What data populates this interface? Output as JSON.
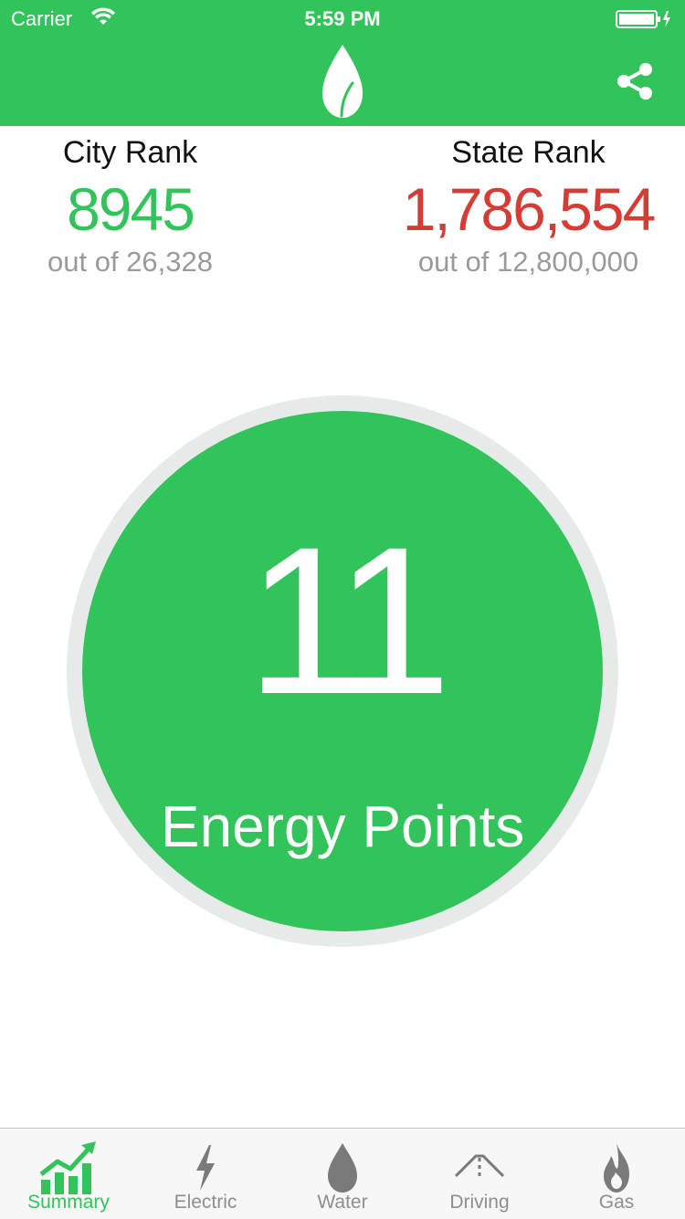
{
  "status_bar": {
    "carrier": "Carrier",
    "time": "5:59 PM"
  },
  "header": {
    "logo_icon": "leaf-icon",
    "share_icon": "share-icon",
    "background_color": "#33c35b"
  },
  "city_rank": {
    "title": "City Rank",
    "value": "8945",
    "subtitle": "out of 26,328",
    "color": "#33c35b"
  },
  "state_rank": {
    "title": "State Rank",
    "value": "1,786,554",
    "subtitle": "out of 12,800,000",
    "color": "#d63b35"
  },
  "energy_points": {
    "value": "11",
    "label": "Energy Points",
    "fill_color": "#33c35b",
    "ring_color": "#e6ebea"
  },
  "tabbar": {
    "items": [
      {
        "label": "Summary",
        "icon": "chart-trend-icon",
        "active": true
      },
      {
        "label": "Electric",
        "icon": "lightning-icon",
        "active": false
      },
      {
        "label": "Water",
        "icon": "water-drop-icon",
        "active": false
      },
      {
        "label": "Driving",
        "icon": "road-icon",
        "active": false
      },
      {
        "label": "Gas",
        "icon": "flame-icon",
        "active": false
      }
    ]
  }
}
